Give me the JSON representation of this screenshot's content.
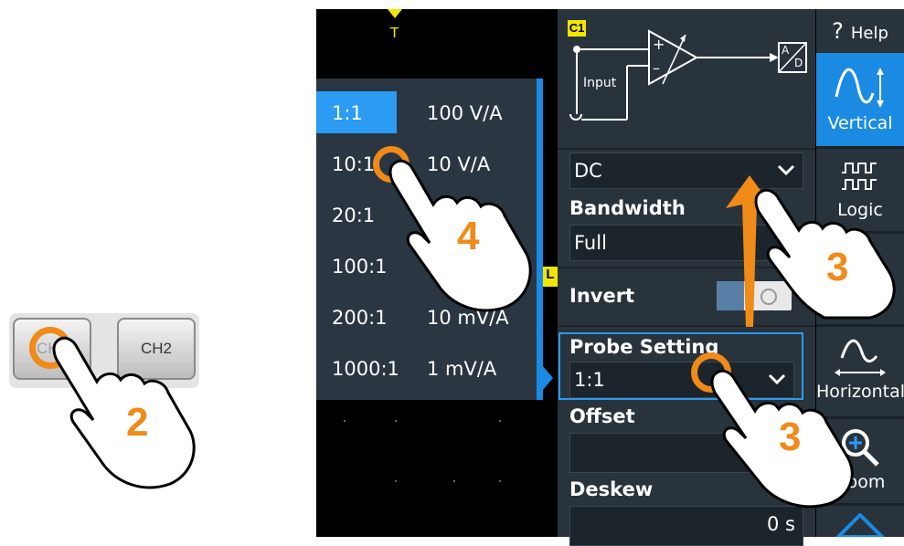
{
  "hardware_keys": {
    "ch1_label": "CH1",
    "ch2_label": "CH2"
  },
  "trigger_marker": "T",
  "probe_ratio_list": {
    "items": [
      {
        "ratio": "1:1",
        "unit": "100 V/A",
        "selected": true
      },
      {
        "ratio": "10:1",
        "unit": "10 V/A",
        "selected": false
      },
      {
        "ratio": "20:1",
        "unit": "",
        "selected": false
      },
      {
        "ratio": "100:1",
        "unit": "",
        "selected": false
      },
      {
        "ratio": "200:1",
        "unit": "10 mV/A",
        "selected": false
      },
      {
        "ratio": "1000:1",
        "unit": "1 mV/A",
        "selected": false
      }
    ]
  },
  "vertical_menu": {
    "channel_badge": "C1",
    "diagram_input_label": "Input",
    "diagram_adc_a": "A",
    "diagram_adc_d": "D",
    "coupling_value": "DC",
    "bandwidth_label": "Bandwidth",
    "bandwidth_value": "Full",
    "invert_label": "Invert",
    "probe_setting_label": "Probe Setting",
    "probe_setting_value": "1:1",
    "offset_label": "Offset",
    "offset_value": "",
    "deskew_label": "Deskew",
    "deskew_value": "0 s",
    "level_marker": "L"
  },
  "toolbar": {
    "help_label": "Help",
    "help_symbol": "?",
    "vertical_label": "Vertical",
    "logic_label": "Logic",
    "horizontal_label": "Horizontal",
    "zoom_label": "Zoom"
  },
  "step_numbers": {
    "step2": "2",
    "step3a": "3",
    "step3b": "3",
    "step4": "4"
  },
  "colors": {
    "accent_blue": "#1b8ae3",
    "highlight_blue": "#2b9bf4",
    "step_orange": "#f08a19",
    "channel_yellow": "#f2e600",
    "menu_bg": "#29333c"
  }
}
